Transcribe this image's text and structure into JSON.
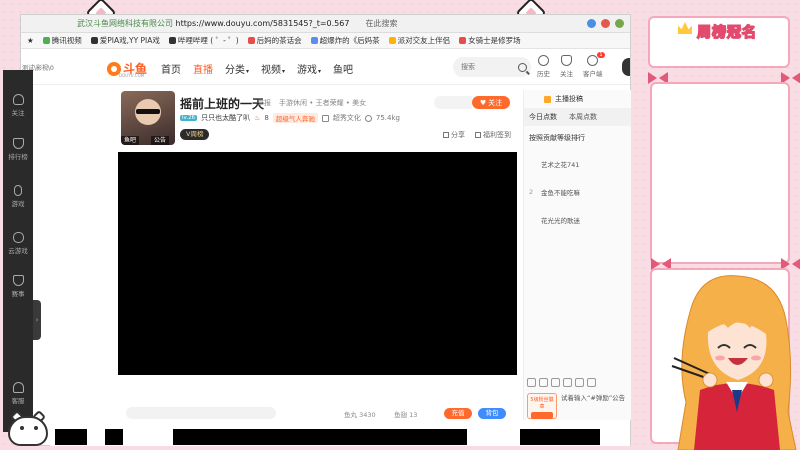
{
  "browser": {
    "url_company": "武汉斗鱼网络科技有限公司",
    "url": "https://www.douyu.com/5831545?_t=0.567",
    "url_search": "在此搜索",
    "bookmarks": [
      "腾讯视频",
      "爱PIA戏,YY PIA戏",
      "哔哩哔哩 ( ゜- ゜)",
      "后妈的茶话会",
      "超爆炸的《后妈茶",
      "派对交友上伴侣",
      "女骑士是修罗场"
    ]
  },
  "site": {
    "left_label": "测试\\影视\\0",
    "logo_text": "斗鱼",
    "logo_sub": "DOUYU.COM",
    "nav": [
      {
        "label": "首页",
        "active": false,
        "caret": false
      },
      {
        "label": "直播",
        "active": true,
        "caret": false
      },
      {
        "label": "分类",
        "active": false,
        "caret": true
      },
      {
        "label": "视频",
        "active": false,
        "caret": true
      },
      {
        "label": "游戏",
        "active": false,
        "caret": true
      },
      {
        "label": "鱼吧",
        "active": false,
        "caret": false
      }
    ],
    "search_placeholder": "搜索",
    "top_actions": [
      "历史",
      "关注",
      "客户端"
    ],
    "client_badge": "1"
  },
  "left_rail": [
    {
      "label": "关注",
      "icon": "heart-icon"
    },
    {
      "label": "排行榜",
      "icon": "trophy-icon"
    },
    {
      "label": "游戏",
      "icon": "mouse-icon"
    },
    {
      "label": "云游戏",
      "icon": "gamepad-icon"
    },
    {
      "label": "赛事",
      "icon": "cup-icon"
    },
    {
      "label": "客服",
      "icon": "headset-icon"
    }
  ],
  "rail_toggle": "›",
  "streamer": {
    "title": "摇前上班的一天",
    "report": "举报",
    "categories": "手游休闲 • 王者荣耀 • 美女",
    "follow_label": "关注",
    "avatar_tags": [
      "鱼吧",
      "公告"
    ],
    "level_badge": "lv.26",
    "name": "只只也太酷了叭",
    "hot_count": "8",
    "hot_tag": "超级气人奔驰",
    "company": "超秀文化",
    "weight": "75.4kg",
    "vip": "V周榜",
    "share": "分享",
    "welfare": "福利签到"
  },
  "below_video": {
    "stat1": "鱼丸 3430",
    "stat2": "鱼翅 13",
    "orange_btn": "充值",
    "blue_btn": "背包"
  },
  "right_panel": {
    "header": "主播投稿",
    "tabs": [
      "今日点数",
      "本周点数"
    ],
    "subtitle": "按照贡献等级排行",
    "ranks": [
      {
        "num": "",
        "name": "艺术之花741"
      },
      {
        "num": "2",
        "name": "金鱼不能吃嘛"
      },
      {
        "num": "",
        "name": "花光光的歌迷"
      }
    ],
    "chat_badge": "5级粉丝徽章",
    "chat_text": "试着输入“#弹励”公告"
  },
  "overlay": {
    "rank_title": "周榜冠名"
  },
  "colors": {
    "accent": "#ff6a2c",
    "blue": "#3f8cff",
    "pink_frame": "#f3a8bb",
    "title_stroke": "#e24b6e"
  }
}
